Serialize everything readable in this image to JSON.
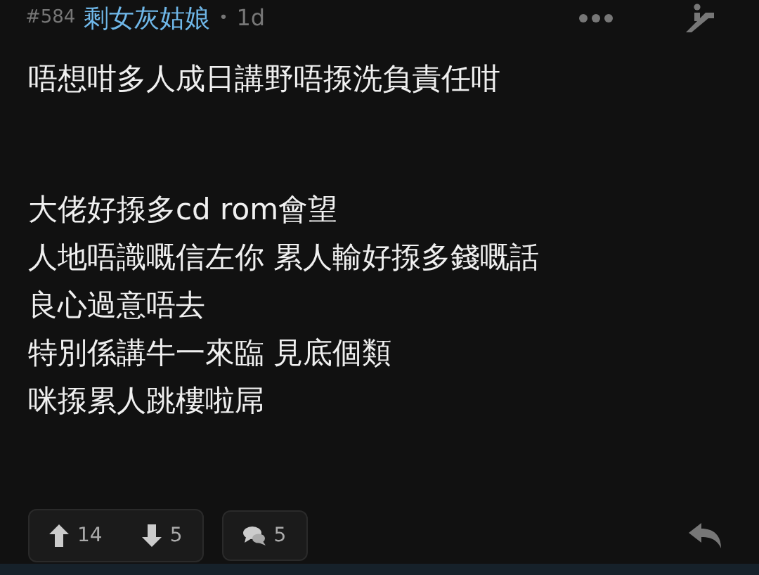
{
  "post": {
    "number": "#584",
    "author": "剩女灰姑娘",
    "separator": "•",
    "age": "1d"
  },
  "paragraphs": [
    [
      "唔想咁多人成日講野唔揼洗負責任咁"
    ],
    [
      "大佬好揼多cd rom會望",
      "人地唔識嘅信左你 累人輸好揼多錢嘅話",
      "良心過意唔去",
      "特別係講牛一來臨 見底個類",
      "咪揼累人跳樓啦屌"
    ]
  ],
  "votes": {
    "up": "14",
    "down": "5"
  },
  "replies": "5"
}
